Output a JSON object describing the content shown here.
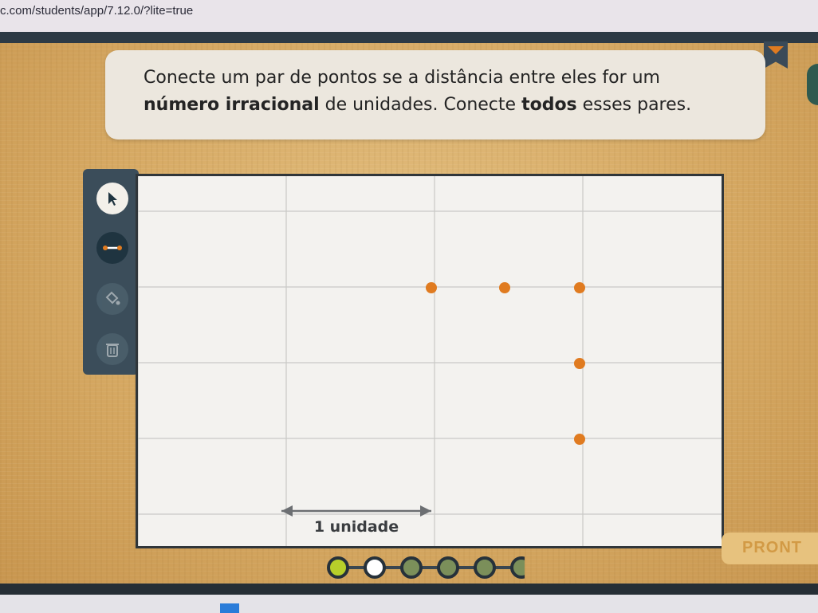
{
  "browser": {
    "url": "c.com/students/app/7.12.0/?lite=true"
  },
  "prompt": {
    "part1": "Conecte um par de pontos se a distância entre eles for um ",
    "bold1": "número irracional",
    "part2": " de unidades. Conecte ",
    "bold2": "todos",
    "part3": " esses pares."
  },
  "toolbar": {
    "tools": [
      {
        "name": "select",
        "icon": "cursor-arrow-icon",
        "active": true
      },
      {
        "name": "segment",
        "icon": "segment-tool-icon",
        "active": false
      },
      {
        "name": "fill",
        "icon": "paint-bucket-icon",
        "active": false
      },
      {
        "name": "delete",
        "icon": "trash-icon",
        "active": false
      }
    ]
  },
  "grid": {
    "unit_label": "1 unidade",
    "points": [
      {
        "col": 2,
        "row": 1
      },
      {
        "col": 2.5,
        "row": 1
      },
      {
        "col": 3,
        "row": 1
      },
      {
        "col": 3,
        "row": 2
      },
      {
        "col": 3,
        "row": 3
      }
    ],
    "point_color": "#e07b20"
  },
  "footer": {
    "ready_label": "PRONT",
    "progress_steps": 6,
    "progress_current": 1,
    "progress_completed": 1
  },
  "colors": {
    "accent": "#e07b20",
    "toolbar": "#3b4d5a",
    "prompt_bg": "#ece7de"
  }
}
